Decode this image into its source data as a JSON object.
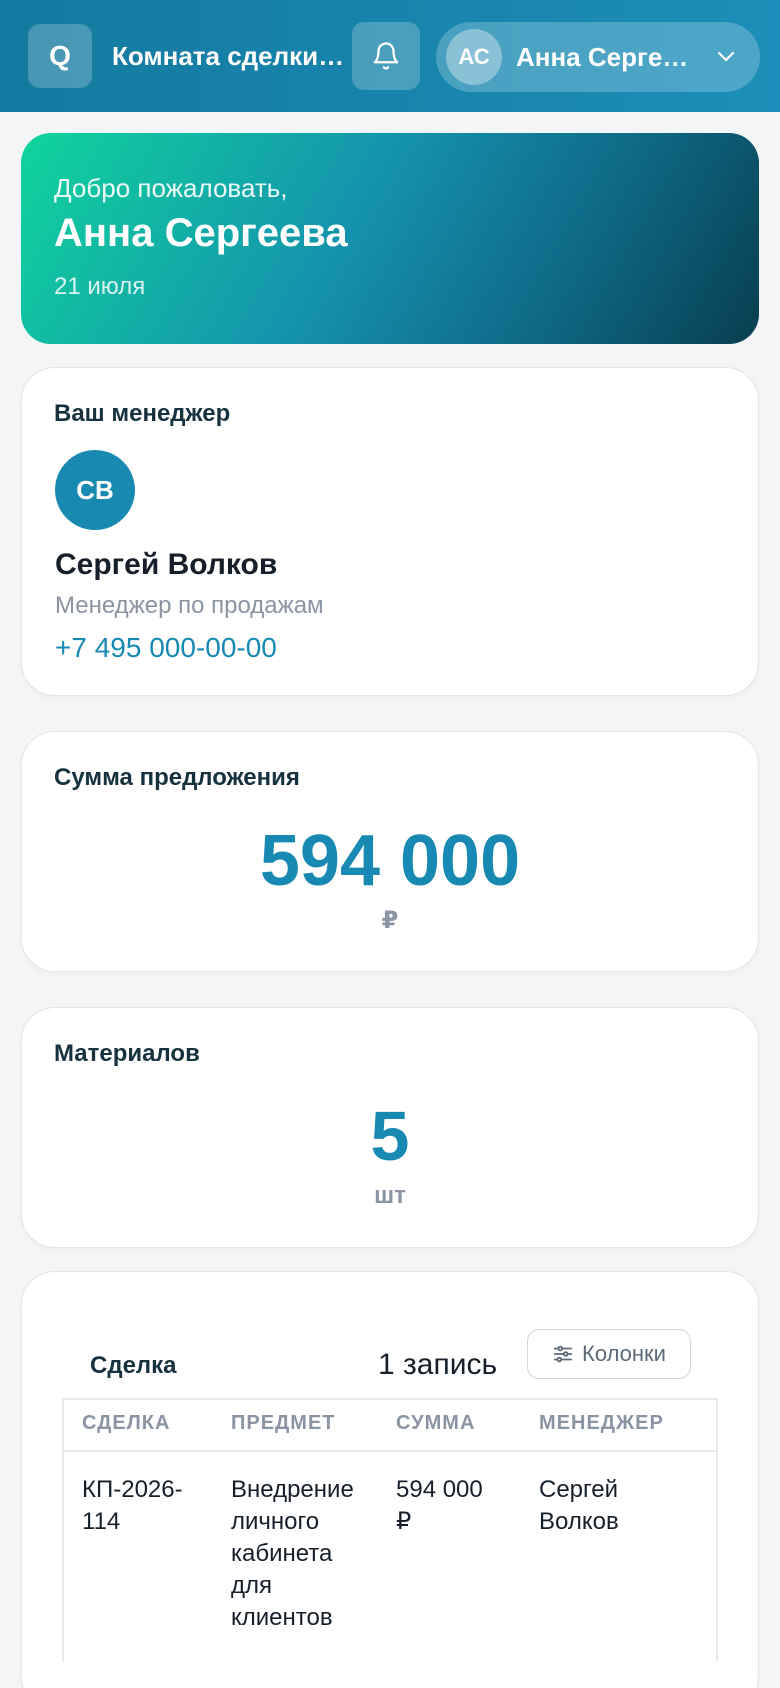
{
  "header": {
    "logo_letter": "Q",
    "room_title": "Комната сделки …",
    "user": {
      "initials": "АС",
      "name": "Анна Сергее…"
    },
    "icons": [
      "bell-icon",
      "chevron-down-icon"
    ]
  },
  "welcome": {
    "greeting": "Добро пожаловать,",
    "name": "Анна Сергеева",
    "date": "21 июля"
  },
  "manager_card": {
    "title": "Ваш менеджер",
    "initials": "СВ",
    "name": "Сергей Волков",
    "role": "Менеджер по продажам",
    "phone": "+7 495 000-00-00"
  },
  "offer_card": {
    "title": "Сумма предложения",
    "value": "594 000",
    "unit": "₽"
  },
  "materials_card": {
    "title": "Материалов",
    "value": "5",
    "unit": "шт"
  },
  "deals_card": {
    "title": "Сделка",
    "record_count": "1 запись",
    "columns_button": "Колонки",
    "columns": [
      "СДЕЛКА",
      "ПРЕДМЕТ",
      "СУММА",
      "МЕНЕДЖЕР"
    ],
    "rows": [
      [
        "КП-2026-\n114",
        "Внедрение\nличного\nкабинета\nдля\nклиентов",
        "594 000\n₽",
        "Сергей\nВолков"
      ]
    ]
  },
  "colors": {
    "accent": "#1789b2",
    "header_bg": "#1789b2",
    "muted_text": "#8b94a3"
  }
}
